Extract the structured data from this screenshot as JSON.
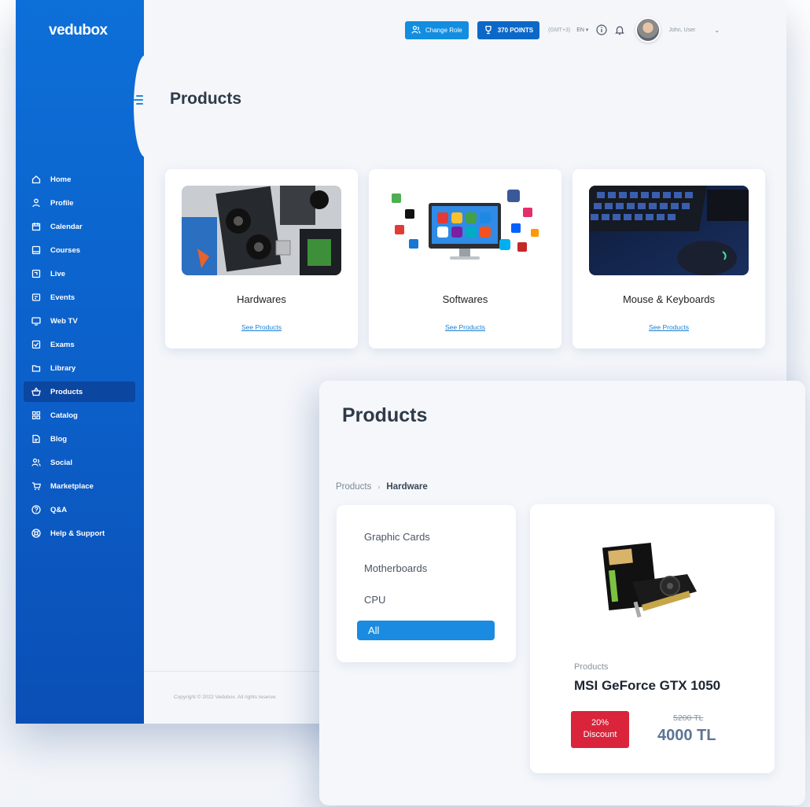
{
  "app": {
    "logo": "vedubox"
  },
  "header": {
    "change_role": "Change Role",
    "points": "370 POINTS",
    "timezone": "(GMT+3)",
    "language": "EN ▾",
    "user_name": "John, User",
    "user_chevron": "⌄"
  },
  "sidebar": {
    "items": [
      {
        "label": "Home",
        "icon": "home-icon"
      },
      {
        "label": "Profile",
        "icon": "user-icon"
      },
      {
        "label": "Calendar",
        "icon": "calendar-icon"
      },
      {
        "label": "Courses",
        "icon": "courses-icon"
      },
      {
        "label": "Live",
        "icon": "live-icon"
      },
      {
        "label": "Events",
        "icon": "events-icon"
      },
      {
        "label": "Web TV",
        "icon": "tv-icon"
      },
      {
        "label": "Exams",
        "icon": "exam-icon"
      },
      {
        "label": "Library",
        "icon": "folder-icon"
      },
      {
        "label": "Products",
        "icon": "basket-icon",
        "active": true
      },
      {
        "label": "Catalog",
        "icon": "grid-icon"
      },
      {
        "label": "Blog",
        "icon": "blog-icon"
      },
      {
        "label": "Social",
        "icon": "people-icon"
      },
      {
        "label": "Marketplace",
        "icon": "cart-icon"
      },
      {
        "label": "Q&A",
        "icon": "question-icon"
      },
      {
        "label": "Help & Support",
        "icon": "lifebuoy-icon"
      }
    ]
  },
  "main": {
    "title": "Products",
    "categories": [
      {
        "name": "Hardwares",
        "link": "See Products"
      },
      {
        "name": "Softwares",
        "link": "See Products"
      },
      {
        "name": "Mouse & Keyboards",
        "link": "See Products"
      }
    ],
    "footer": "Copyright © 2022 Vedubox. All rights reserve"
  },
  "overlay": {
    "title": "Products",
    "breadcrumb": {
      "root": "Products",
      "separator": "›",
      "current": "Hardware"
    },
    "filters": [
      "Graphic Cards",
      "Motherboards",
      "CPU",
      "All"
    ],
    "product": {
      "category": "Products",
      "name": "MSI GeForce GTX 1050",
      "discount_percent": "20%",
      "discount_label": "Discount",
      "old_price": "5200 TL",
      "new_price": "4000 TL"
    }
  },
  "colors": {
    "primary": "#138de0",
    "sidebar": "#0c5fc9",
    "discount": "#d9243b",
    "price": "#5c7594"
  }
}
